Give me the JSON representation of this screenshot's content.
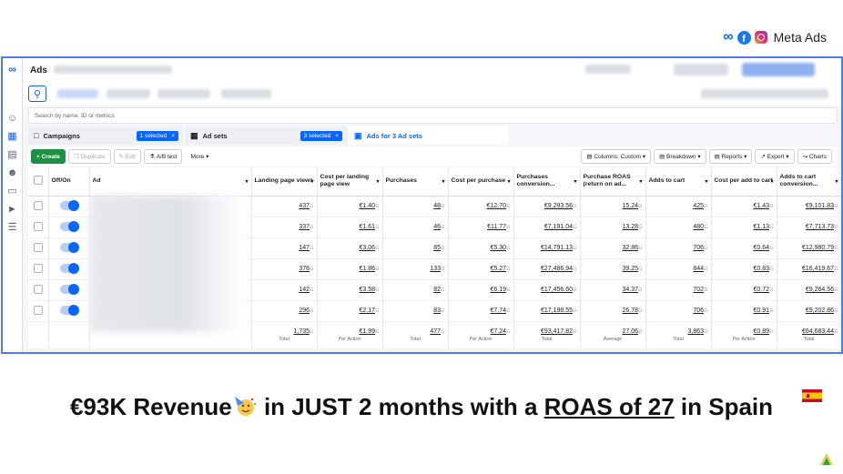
{
  "brand": {
    "label": "Meta Ads"
  },
  "app": {
    "title": "Ads"
  },
  "search": {
    "placeholder": "Search by name, ID or metrics"
  },
  "tabs": [
    {
      "label": "Campaigns",
      "chip": "1 selected"
    },
    {
      "label": "Ad sets",
      "chip": "3 selected"
    },
    {
      "label": "Ads for 3 Ad sets"
    }
  ],
  "toolbar": {
    "create": "Create",
    "duplicate": "Duplicate",
    "edit": "Edit",
    "ab_test": "A/B test",
    "more": "More",
    "columns": "Columns: Custom",
    "breakdown": "Breakdown",
    "reports": "Reports",
    "export": "Export",
    "charts": "Charts"
  },
  "table": {
    "headers": {
      "offon": "Off/On",
      "ad": "Ad",
      "lpv": "Landing page views",
      "cplpv": "Cost per landing page view",
      "purchases": "Purchases",
      "cpp": "Cost per purchase",
      "pcv": "Purchases conversion...",
      "roas": "Purchase ROAS (return on ad...",
      "atc": "Adds to cart",
      "cpatc": "Cost per add to cart",
      "atcv": "Adds to cart conversion..."
    },
    "rows": [
      [
        "437",
        "€1.40",
        "48",
        "€12.70",
        "€9,293.56",
        "15.24",
        "425",
        "€1.43",
        "€9,101.83"
      ],
      [
        "337",
        "€1.61",
        "46",
        "€11.77",
        "€7,191.04",
        "13.28",
        "480",
        "€1.13",
        "€7,713.73"
      ],
      [
        "147",
        "€3.06",
        "85",
        "€5.30",
        "€14,791.13",
        "32.86",
        "706",
        "€0.64",
        "€12,980.79"
      ],
      [
        "376",
        "€1.86",
        "133",
        "€5.27",
        "€27,486.94",
        "39.25",
        "844",
        "€0.83",
        "€16,419.67"
      ],
      [
        "142",
        "€3.58",
        "82",
        "€6.19",
        "€17,456.60",
        "34.37",
        "702",
        "€0.72",
        "€9,264.56"
      ],
      [
        "296",
        "€2.17",
        "83",
        "€7.74",
        "€17,198.55",
        "26.78",
        "706",
        "€0.91",
        "€9,202.86"
      ]
    ],
    "totals": [
      "1,735",
      "€1.99",
      "477",
      "€7.24",
      "€93,417.82",
      "27.06",
      "3,863",
      "€0.89",
      "€64,683.44"
    ],
    "total_subs": [
      "Total",
      "Per Action",
      "Total",
      "Per Action",
      "Total",
      "Average",
      "Total",
      "Per Action",
      "Total"
    ]
  },
  "headline": {
    "part1": "€93K Revenue",
    "part2": " in JUST 2 months with a ",
    "roas": "ROAS of 27",
    "part3": " in Spain"
  },
  "colors": {
    "accent": "#0866ff",
    "create": "#1f8f46",
    "ring_revenue": "#1aa84a",
    "ring_roas": "#e0262f"
  }
}
